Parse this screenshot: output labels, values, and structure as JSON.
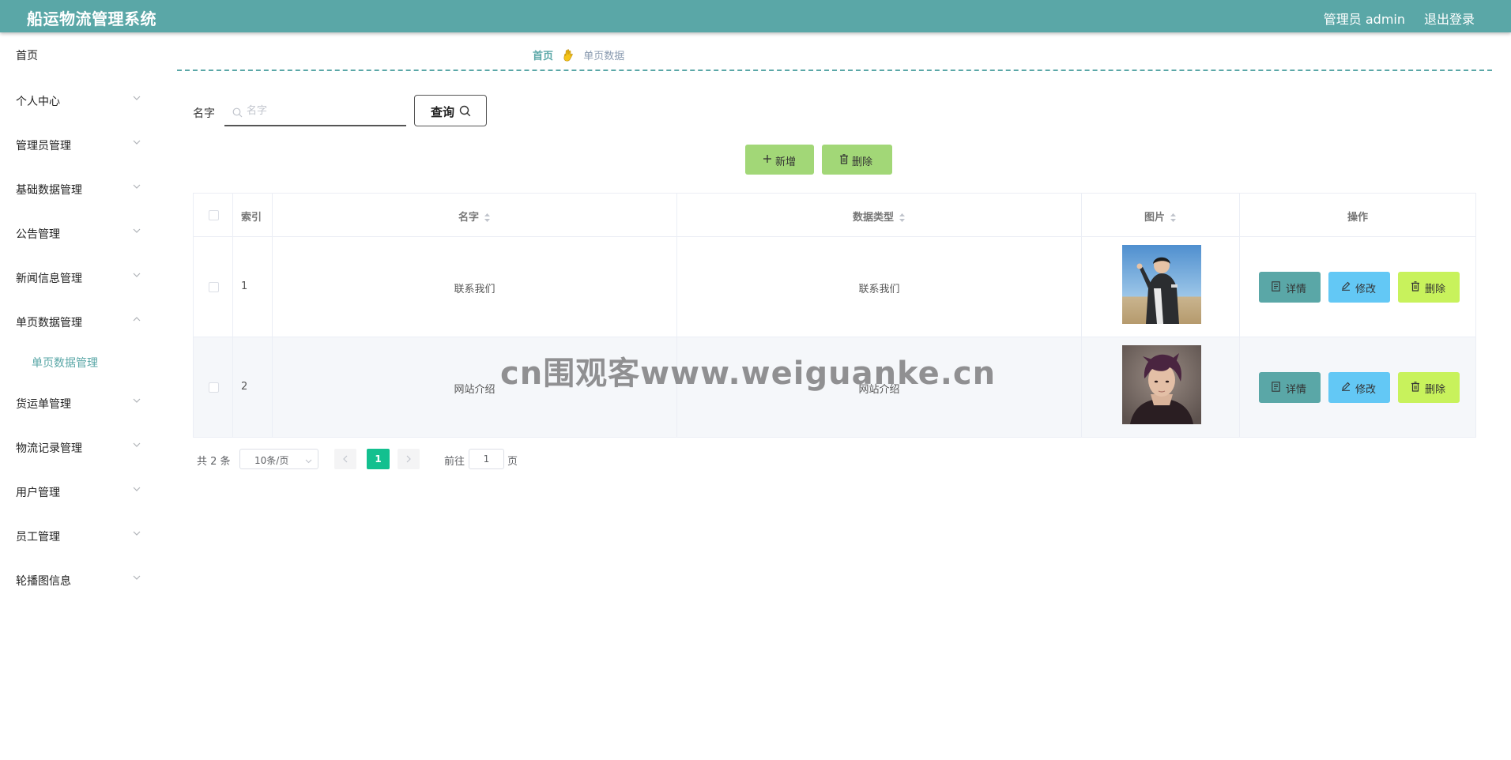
{
  "header": {
    "app_title": "船运物流管理系统",
    "user_info": "管理员 admin",
    "logout_label": "退出登录"
  },
  "sidebar": {
    "items": [
      {
        "label": "首页",
        "icon": "none"
      },
      {
        "label": "个人中心",
        "icon": "chevron-down-icon"
      },
      {
        "label": "管理员管理",
        "icon": "chevron-down-icon"
      },
      {
        "label": "基础数据管理",
        "icon": "chevron-down-icon"
      },
      {
        "label": "公告管理",
        "icon": "chevron-down-icon"
      },
      {
        "label": "新闻信息管理",
        "icon": "chevron-down-icon"
      },
      {
        "label": "单页数据管理",
        "icon": "chevron-up-icon",
        "expanded": true
      },
      {
        "label": "货运单管理",
        "icon": "chevron-down-icon"
      },
      {
        "label": "物流记录管理",
        "icon": "chevron-down-icon"
      },
      {
        "label": "用户管理",
        "icon": "chevron-down-icon"
      },
      {
        "label": "员工管理",
        "icon": "chevron-down-icon"
      },
      {
        "label": "轮播图信息",
        "icon": "chevron-down-icon"
      }
    ],
    "submenu": [
      {
        "label": "单页数据管理",
        "active": true
      }
    ],
    "active_color": "#5aa7a7"
  },
  "breadcrumb": {
    "home": "首页",
    "icon": "hand-icon",
    "current": "单页数据"
  },
  "search": {
    "label": "名字",
    "placeholder": "名字",
    "value": "",
    "button_label": "查询"
  },
  "actions": {
    "add_label": "新增",
    "delete_label": "删除",
    "color": "#a2d777"
  },
  "table": {
    "headers": {
      "index": "索引",
      "name": "名字",
      "data_type": "数据类型",
      "image": "图片",
      "operation": "操作"
    },
    "rows": [
      {
        "index": "1",
        "name": "联系我们",
        "data_type": "联系我们",
        "image": "person-photo-1"
      },
      {
        "index": "2",
        "name": "网站介绍",
        "data_type": "网站介绍",
        "image": "person-photo-2"
      }
    ],
    "row_buttons": {
      "detail": "详情",
      "edit": "修改",
      "delete": "删除"
    },
    "button_colors": {
      "detail": "#5aa7a7",
      "edit": "#63c8f5",
      "delete": "#c8f25c"
    }
  },
  "pagination": {
    "total_text": "共 2 条",
    "page_size": "10条/页",
    "current_page": "1",
    "goto_label": "前往",
    "goto_value": "1",
    "page_suffix": "页",
    "active_color": "#13c08f"
  },
  "watermark": "cn围观客www.weiguanke.cn",
  "colors": {
    "header": "#5aa7a7",
    "accent": "#5aa7a7"
  }
}
